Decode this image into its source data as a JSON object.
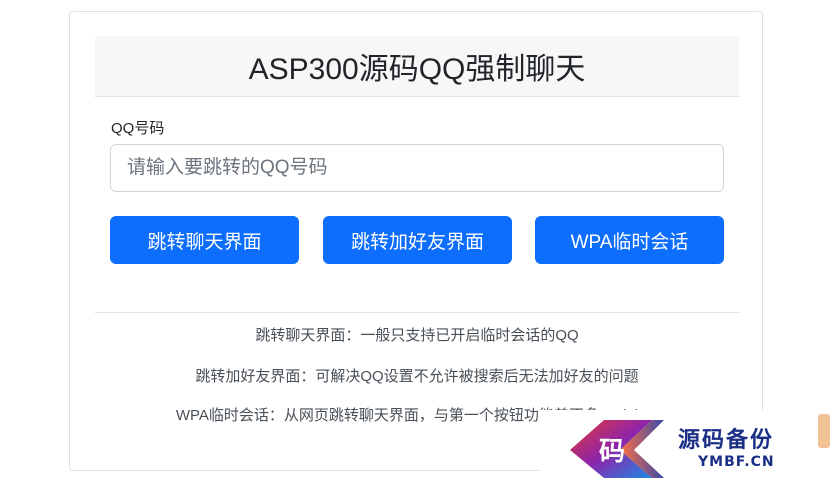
{
  "header": {
    "title": "ASP300源码QQ强制聊天"
  },
  "form": {
    "label": "QQ号码",
    "input_value": "",
    "input_placeholder": "请输入要跳转的QQ号码"
  },
  "buttons": {
    "chat": "跳转聊天界面",
    "add_friend": "跳转加好友界面",
    "wpa": "WPA临时会话"
  },
  "notes": [
    "跳转聊天界面：一般只支持已开启临时会话的QQ",
    "跳转加好友界面：可解决QQ设置不允许被搜索后无法加好友的问题",
    "WPA临时会话：从网页跳转聊天界面，与第一个按钮功能差不多 xydai.cn"
  ],
  "watermark": {
    "logo_char": "码",
    "title": "源码备份",
    "url": "YMBF.CN"
  },
  "colors": {
    "primary": "#0d6efd",
    "header_bg": "#f7f7f8",
    "border": "#dee2e6",
    "watermark_text": "#1b2f86"
  }
}
